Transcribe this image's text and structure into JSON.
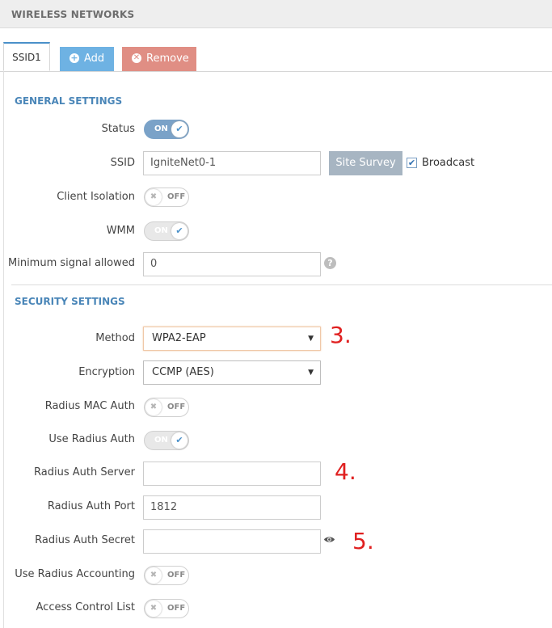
{
  "header": {
    "title": "WIRELESS NETWORKS"
  },
  "tabs": {
    "active": "SSID1",
    "add_label": "Add",
    "remove_label": "Remove"
  },
  "general": {
    "title": "GENERAL SETTINGS",
    "status": {
      "label": "Status",
      "toggle": "ON"
    },
    "ssid": {
      "label": "SSID",
      "value": "IgniteNet0-1",
      "survey_label": "Site Survey",
      "broadcast_label": "Broadcast",
      "broadcast_checked": true
    },
    "client_isolation": {
      "label": "Client Isolation",
      "toggle": "OFF"
    },
    "wmm": {
      "label": "WMM",
      "toggle": "ON"
    },
    "min_signal": {
      "label": "Minimum signal allowed",
      "value": "0"
    }
  },
  "security": {
    "title": "SECURITY SETTINGS",
    "method": {
      "label": "Method",
      "value": "WPA2-EAP"
    },
    "encryption": {
      "label": "Encryption",
      "value": "CCMP (AES)"
    },
    "radius_mac_auth": {
      "label": "Radius MAC Auth",
      "toggle": "OFF"
    },
    "use_radius_auth": {
      "label": "Use Radius Auth",
      "toggle": "ON"
    },
    "radius_auth_server": {
      "label": "Radius Auth Server",
      "value": ""
    },
    "radius_auth_port": {
      "label": "Radius Auth Port",
      "value": "1812"
    },
    "radius_auth_secret": {
      "label": "Radius Auth Secret",
      "value": ""
    },
    "use_radius_accounting": {
      "label": "Use Radius Accounting",
      "toggle": "OFF"
    },
    "access_control_list": {
      "label": "Access Control List",
      "toggle": "OFF"
    }
  },
  "annotations": {
    "a3": "3.",
    "a4": "4.",
    "a5": "5."
  },
  "colors": {
    "accent": "#4a86b8",
    "toggle_on": "#7aa2c8",
    "add": "#6eb2e3",
    "remove": "#e08e84",
    "annotation": "#e02020"
  },
  "icons": {
    "add": "plus-circle-icon",
    "remove": "x-circle-icon",
    "help": "question-circle-icon",
    "reveal": "eye-icon"
  }
}
